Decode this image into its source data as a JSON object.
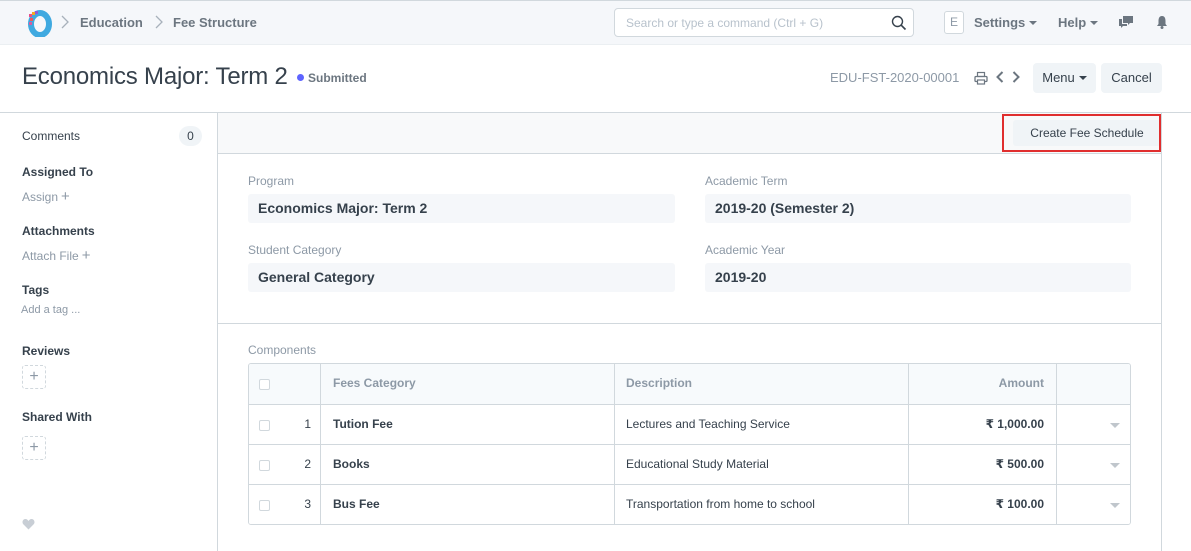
{
  "navbar": {
    "breadcrumbs": [
      "Education",
      "Fee Structure"
    ],
    "search_placeholder": "Search or type a command (Ctrl + G)",
    "avatar_initial": "E",
    "settings_label": "Settings",
    "help_label": "Help",
    "icons": [
      "app-logo",
      "search-icon",
      "chat-icon",
      "bell-icon"
    ]
  },
  "page": {
    "title": "Economics Major: Term 2",
    "status": "Submitted",
    "status_color": "#5e64ff",
    "doc_id": "EDU-FST-2020-00001",
    "menu_label": "Menu",
    "cancel_label": "Cancel"
  },
  "sidebar": {
    "comments_label": "Comments",
    "comments_count": "0",
    "assigned_to_label": "Assigned To",
    "assign_link": "Assign",
    "attachments_label": "Attachments",
    "attach_link": "Attach File",
    "tags_label": "Tags",
    "add_tag_link": "Add a tag ...",
    "reviews_label": "Reviews",
    "shared_with_label": "Shared With"
  },
  "form": {
    "create_fee_schedule_label": "Create Fee Schedule",
    "highlight_color": "#e02e2e",
    "fields": {
      "program": {
        "label": "Program",
        "value": "Economics Major: Term 2"
      },
      "academic_term": {
        "label": "Academic Term",
        "value": "2019-20 (Semester 2)"
      },
      "student_category": {
        "label": "Student Category",
        "value": "General Category"
      },
      "academic_year": {
        "label": "Academic Year",
        "value": "2019-20"
      }
    },
    "components": {
      "label": "Components",
      "columns": [
        "Fees Category",
        "Description",
        "Amount"
      ],
      "rows": [
        {
          "idx": "1",
          "category": "Tution Fee",
          "description": "Lectures and Teaching Service",
          "amount": "₹ 1,000.00"
        },
        {
          "idx": "2",
          "category": "Books",
          "description": "Educational Study Material",
          "amount": "₹ 500.00"
        },
        {
          "idx": "3",
          "category": "Bus Fee",
          "description": "Transportation from home to school",
          "amount": "₹ 100.00"
        }
      ]
    }
  }
}
